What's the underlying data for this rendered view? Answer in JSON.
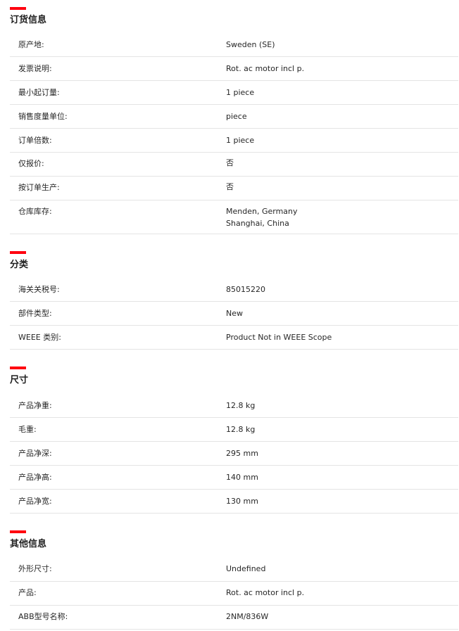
{
  "accent_color": "#ff000f",
  "sections": [
    {
      "title": "订货信息",
      "rows": [
        {
          "label": "原产地:",
          "values": [
            "Sweden (SE)"
          ]
        },
        {
          "label": "发票说明:",
          "values": [
            "Rot. ac motor incl p."
          ]
        },
        {
          "label": "最小起订量:",
          "values": [
            "1 piece"
          ]
        },
        {
          "label": "销售度量单位:",
          "values": [
            "piece"
          ]
        },
        {
          "label": "订单倍数:",
          "values": [
            "1 piece"
          ]
        },
        {
          "label": "仅报价:",
          "values": [
            "否"
          ]
        },
        {
          "label": "按订单生产:",
          "values": [
            "否"
          ]
        },
        {
          "label": "仓库库存:",
          "values": [
            "Menden, Germany",
            "Shanghai, China"
          ]
        }
      ]
    },
    {
      "title": "分类",
      "rows": [
        {
          "label": "海关关税号:",
          "values": [
            "85015220"
          ]
        },
        {
          "label": "部件类型:",
          "values": [
            "New"
          ]
        },
        {
          "label": "WEEE 类别:",
          "values": [
            "Product Not in WEEE Scope"
          ]
        }
      ]
    },
    {
      "title": "尺寸",
      "rows": [
        {
          "label": "产品净重:",
          "values": [
            "12.8 kg"
          ]
        },
        {
          "label": "毛重:",
          "values": [
            "12.8 kg"
          ]
        },
        {
          "label": "产品净深:",
          "values": [
            "295 mm"
          ]
        },
        {
          "label": "产品净高:",
          "values": [
            "140 mm"
          ]
        },
        {
          "label": "产品净宽:",
          "values": [
            "130 mm"
          ]
        }
      ]
    },
    {
      "title": "其他信息",
      "rows": [
        {
          "label": "外形尺寸:",
          "values": [
            "Undefined"
          ]
        },
        {
          "label": "产品:",
          "values": [
            "Rot. ac motor incl p."
          ]
        },
        {
          "label": "ABB型号名称:",
          "values": [
            "2NM/836W"
          ]
        }
      ]
    }
  ]
}
